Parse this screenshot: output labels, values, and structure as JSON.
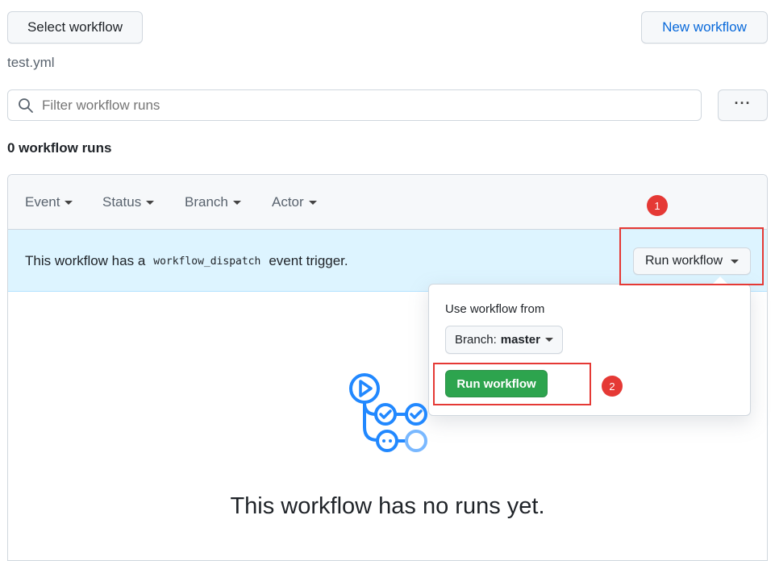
{
  "header": {
    "select_workflow": "Select workflow",
    "new_workflow": "New workflow",
    "file_name": "test.yml"
  },
  "search": {
    "placeholder": "Filter workflow runs",
    "more_label": "···"
  },
  "runs_count": "0 workflow runs",
  "filters": [
    {
      "label": "Event"
    },
    {
      "label": "Status"
    },
    {
      "label": "Branch"
    },
    {
      "label": "Actor"
    }
  ],
  "trigger_banner": {
    "text_before": "This workflow has a",
    "code": "workflow_dispatch",
    "text_after": "event trigger.",
    "run_button": "Run workflow"
  },
  "dropdown": {
    "use_from_label": "Use workflow from",
    "branch_prefix": "Branch:",
    "branch_value": "master",
    "run_button": "Run workflow"
  },
  "empty_state": {
    "title": "This workflow has no runs yet."
  },
  "annotations": [
    {
      "number": "1"
    },
    {
      "number": "2"
    }
  ],
  "colors": {
    "accent_blue": "#0969da",
    "banner_bg": "#ddf4ff",
    "primary_green": "#2da44e",
    "annotation_red": "#e53935",
    "icon_blue": "#2188ff"
  }
}
